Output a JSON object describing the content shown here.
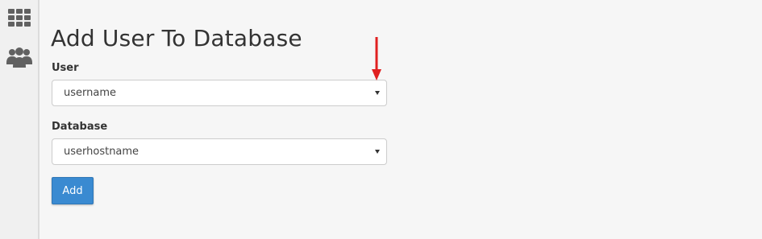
{
  "sidebar": {
    "items": [
      {
        "icon": "grid-icon"
      },
      {
        "icon": "users-icon"
      }
    ]
  },
  "page": {
    "title": "Add User To Database"
  },
  "form": {
    "user": {
      "label": "User",
      "value": "username"
    },
    "database": {
      "label": "Database",
      "value": "userhostname"
    },
    "add_label": "Add"
  },
  "annotation": {
    "color": "#e02020"
  },
  "colors": {
    "accent": "#3a8ad1",
    "icon": "#616161"
  }
}
